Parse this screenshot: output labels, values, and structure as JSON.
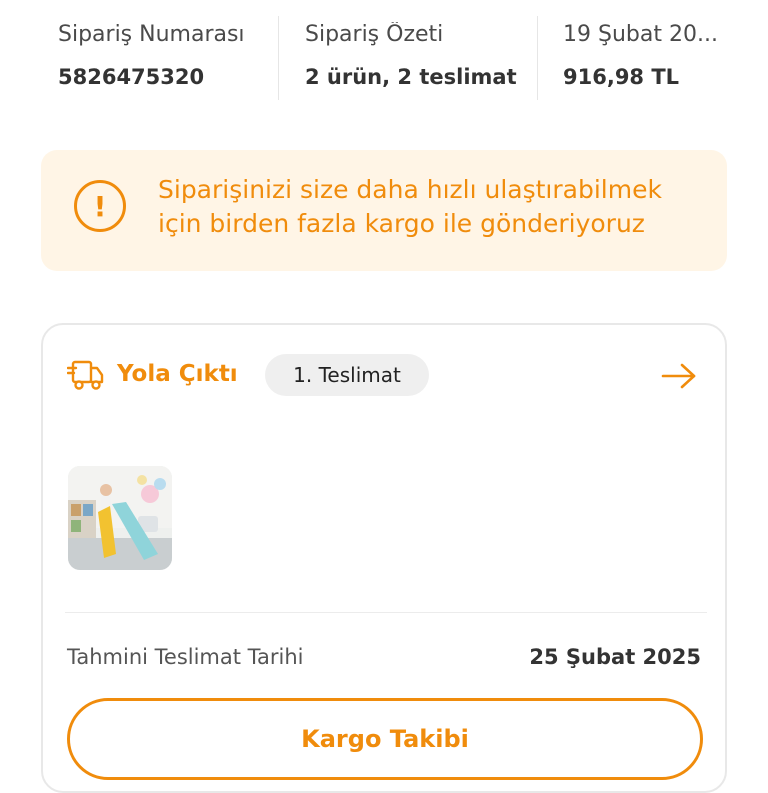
{
  "summary": {
    "order_number_label": "Sipariş Numarası",
    "order_number": "5826475320",
    "order_summary_label": "Sipariş Özeti",
    "order_summary": "2 ürün, 2 teslimat",
    "date_label": "19 Şubat 20...",
    "total": "916,98 TL"
  },
  "banner": {
    "icon": "warning-icon",
    "line1": "Siparişinizi size daha hızlı ulaştırabilmek",
    "line2": "için birden fazla kargo ile gönderiyoruz"
  },
  "delivery": {
    "status_icon": "truck-icon",
    "status": "Yola Çıktı",
    "badge": "1. Teslimat",
    "estimate_label": "Tahmini Teslimat Tarihi",
    "estimate_date": "25 Şubat 2025",
    "track_button": "Kargo Takibi"
  },
  "colors": {
    "accent": "#f08c0c",
    "banner_bg": "#fff5e6"
  }
}
